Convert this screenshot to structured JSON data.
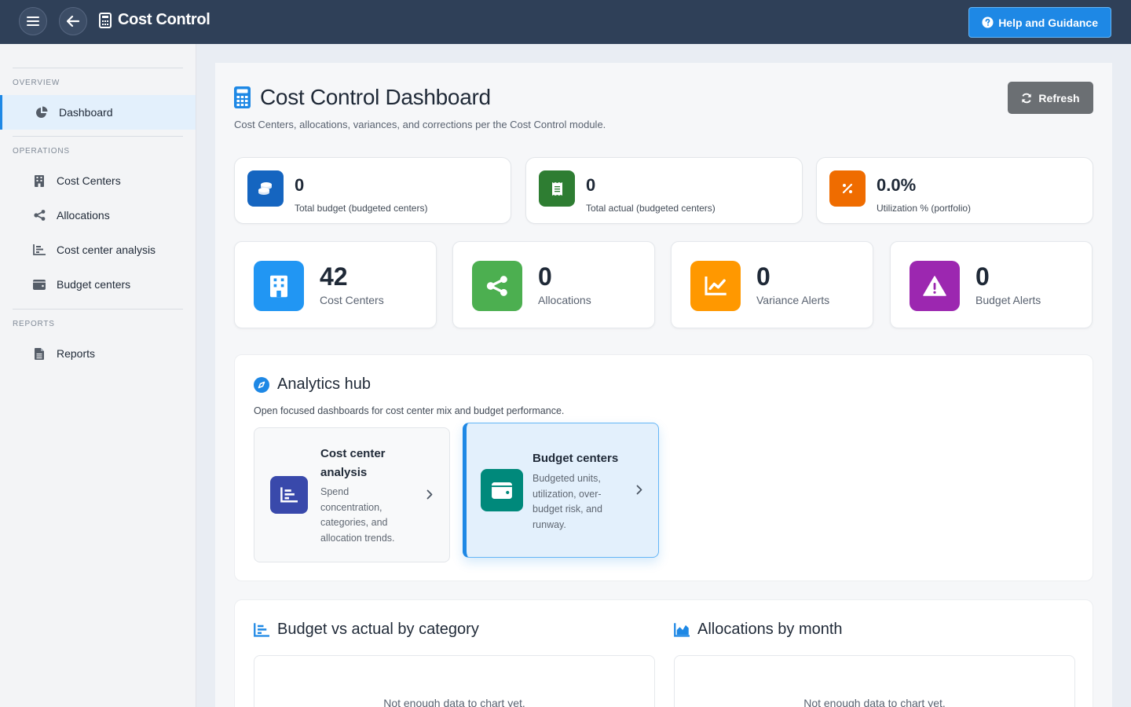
{
  "header": {
    "title": "Cost Control",
    "help_label": "Help and Guidance"
  },
  "sidebar": {
    "sections": [
      {
        "label": "OVERVIEW",
        "items": [
          {
            "label": "Dashboard",
            "icon": "pie-chart-icon",
            "active": true
          }
        ]
      },
      {
        "label": "OPERATIONS",
        "items": [
          {
            "label": "Cost Centers",
            "icon": "building-icon"
          },
          {
            "label": "Allocations",
            "icon": "share-nodes-icon"
          },
          {
            "label": "Cost center analysis",
            "icon": "bar-chart-icon"
          },
          {
            "label": "Budget centers",
            "icon": "wallet-icon"
          }
        ]
      },
      {
        "label": "REPORTS",
        "items": [
          {
            "label": "Reports",
            "icon": "document-icon"
          }
        ]
      }
    ]
  },
  "page": {
    "title": "Cost Control Dashboard",
    "subtitle": "Cost Centers, allocations, variances, and corrections per the Cost Control module.",
    "refresh_label": "Refresh"
  },
  "kpis": [
    {
      "value": "0",
      "label": "Total budget (budgeted centers)",
      "icon": "coins-icon",
      "color": "#1565c0"
    },
    {
      "value": "0",
      "label": "Total actual (budgeted centers)",
      "icon": "receipt-icon",
      "color": "#2e7d32"
    },
    {
      "value": "0.0%",
      "label": "Utilization % (portfolio)",
      "icon": "percent-icon",
      "color": "#ef6c00"
    }
  ],
  "stats": [
    {
      "value": "42",
      "label": "Cost Centers",
      "icon": "building-icon",
      "color": "#2196f3"
    },
    {
      "value": "0",
      "label": "Allocations",
      "icon": "share-nodes-icon",
      "color": "#4caf50"
    },
    {
      "value": "0",
      "label": "Variance Alerts",
      "icon": "line-chart-icon",
      "color": "#ff9800"
    },
    {
      "value": "0",
      "label": "Budget Alerts",
      "icon": "warning-icon",
      "color": "#9c27b0"
    }
  ],
  "hub": {
    "title": "Analytics hub",
    "subtitle": "Open focused dashboards for cost center mix and budget performance.",
    "cards": [
      {
        "title_l1": "Cost center",
        "title_l2": "analysis",
        "desc": [
          "Spend",
          "concentration,",
          "categories, and",
          "allocation trends."
        ],
        "icon": "bar-chart-icon",
        "color": "#3949ab"
      },
      {
        "title_l1": "Budget centers",
        "desc": [
          "Budgeted units,",
          "utilization, over-",
          "budget risk, and",
          "runway."
        ],
        "icon": "wallet-icon",
        "color": "#00897b"
      }
    ]
  },
  "charts": [
    {
      "title": "Budget vs actual by category",
      "empty": "Not enough data to chart yet."
    },
    {
      "title": "Allocations by month",
      "empty": "Not enough data to chart yet."
    }
  ]
}
